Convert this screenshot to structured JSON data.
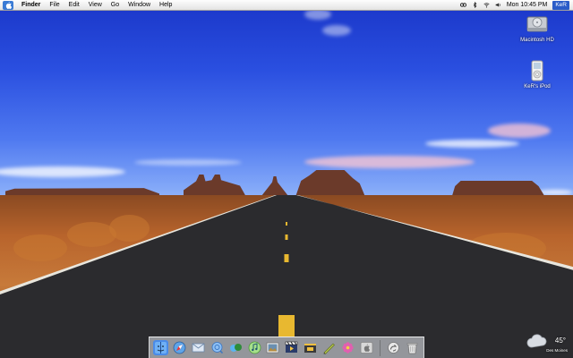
{
  "menubar": {
    "app_name": "Finder",
    "menus": [
      "File",
      "Edit",
      "View",
      "Go",
      "Window",
      "Help"
    ],
    "clock": "Mon 10:45 PM",
    "user": "KeR"
  },
  "desktop": {
    "icons": [
      {
        "label": "Macintosh HD",
        "icon": "hard-drive-icon"
      },
      {
        "label": "KeR's iPod",
        "icon": "ipod-icon"
      }
    ]
  },
  "dock": {
    "apps": [
      {
        "name": "finder-icon",
        "color": "#4a8be8"
      },
      {
        "name": "safari-icon",
        "color": "#5fa4e8"
      },
      {
        "name": "mail-icon",
        "color": "#9bb4d8"
      },
      {
        "name": "ichat-icon",
        "color": "#4f8fe0"
      },
      {
        "name": "sherlock-icon",
        "color": "#7aa6d6"
      },
      {
        "name": "itunes-icon",
        "color": "#7ccf6a"
      },
      {
        "name": "iphoto-icon",
        "color": "#6a8fb0"
      },
      {
        "name": "imovie-icon",
        "color": "#3d5fa8"
      },
      {
        "name": "idvd-icon",
        "color": "#f0c040"
      },
      {
        "name": "iwork-icon",
        "color": "#b0c04a"
      },
      {
        "name": "photo-booth-icon",
        "color": "#e060b0"
      },
      {
        "name": "system-preferences-icon",
        "color": "#a8a8a8"
      }
    ],
    "right_items": [
      {
        "name": "documents-stack-icon",
        "color": "#c0c0c0"
      },
      {
        "name": "trash-icon",
        "color": "#d0d0d0"
      }
    ]
  },
  "weather_widget": {
    "temperature": "45°",
    "city": "Des Moines"
  }
}
